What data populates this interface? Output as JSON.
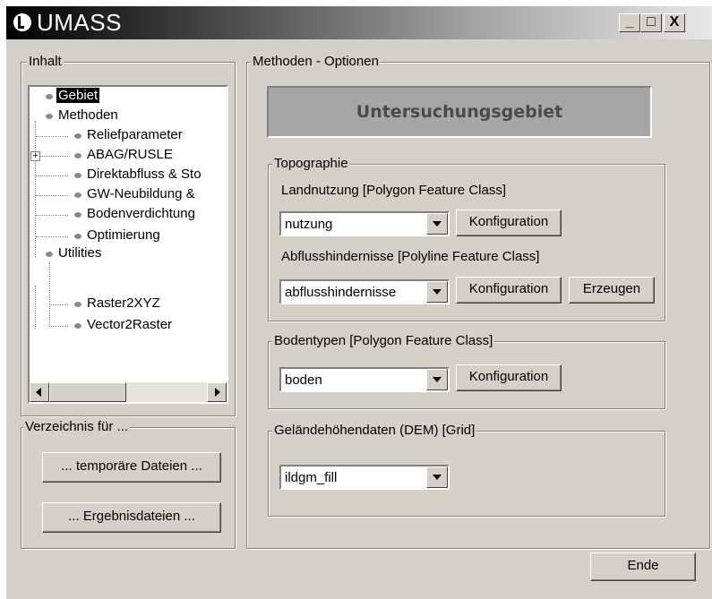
{
  "window": {
    "title": "UMASS",
    "minimize_label": "_",
    "maximize_label": "□",
    "close_label": "X"
  },
  "inhalt": {
    "group_label": "Inhalt",
    "tree": [
      {
        "label": "Gebiet",
        "selected": true
      },
      {
        "label": "Methoden"
      },
      {
        "label": "Reliefparameter"
      },
      {
        "label": "ABAG/RUSLE",
        "expander": "+"
      },
      {
        "label": "Direktabfluss & Sto"
      },
      {
        "label": "GW-Neubildung &"
      },
      {
        "label": "Bodenverdichtung"
      },
      {
        "label": "Optimierung"
      },
      {
        "label": "Utilities"
      },
      {
        "label": "Raster2XYZ"
      },
      {
        "label": "Vector2Raster"
      }
    ]
  },
  "verzeichnis": {
    "group_label": "Verzeichnis für ...",
    "temp_button": "... temporäre Dateien ...",
    "result_button": "... Ergebnisdateien ..."
  },
  "methoden": {
    "group_label": "Methoden - Optionen",
    "header": "Untersuchungsgebiet",
    "topographie": {
      "group_label": "Topographie",
      "landnutzung_label": "Landnutzung [Polygon Feature Class]",
      "landnutzung_value": "nutzung",
      "landnutzung_config": "Konfiguration",
      "abfluss_label": "Abflusshindernisse [Polyline Feature Class]",
      "abfluss_value": "abflusshindernisse",
      "abfluss_config": "Konfiguration",
      "abfluss_create": "Erzeugen"
    },
    "bodentypen": {
      "group_label": "Bodentypen [Polygon Feature Class]",
      "value": "boden",
      "config": "Konfiguration"
    },
    "dem": {
      "group_label": "Geländehöhendaten (DEM) [Grid]",
      "value": "ildgm_fill"
    }
  },
  "footer": {
    "end_button": "Ende"
  }
}
